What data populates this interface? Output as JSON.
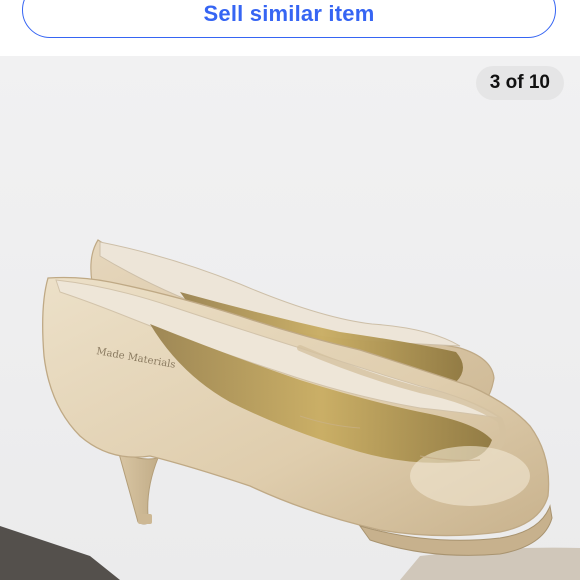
{
  "header": {
    "sell_button_label": "Sell similar item"
  },
  "gallery": {
    "counter_text": "3 of 10",
    "current_index": 3,
    "total_images": 10,
    "image_label": "Made Materials"
  },
  "colors": {
    "accent": "#3665f3",
    "gallery_background": "#f0f0f1",
    "counter_background": "#e5e5e6"
  }
}
